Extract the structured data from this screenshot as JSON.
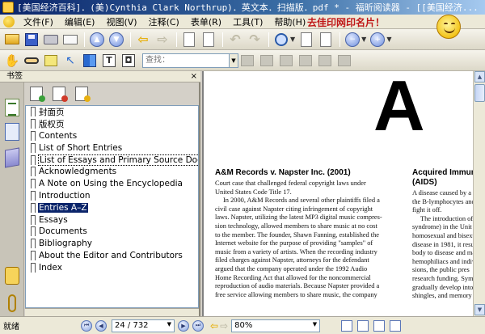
{
  "window": {
    "title": "[美国经济百科]．(美)Cynthia Clark Northrup)．英文本．扫描版．pdf * - 福昕阅读器 - [[美国经济..."
  },
  "menu": {
    "items": [
      "文件(F)",
      "编辑(E)",
      "视图(V)",
      "注释(C)",
      "表单(R)",
      "工具(T)",
      "帮助(H)"
    ],
    "brand_text": "去佳印网印名片！"
  },
  "toolbar": {
    "search_placeholder": "查找："
  },
  "panel": {
    "title": "书签",
    "close_label": "×",
    "bookmarks": [
      "封面页",
      "版权页",
      "Contents",
      "List of Short Entries",
      "List of Essays and Primary Source Documents",
      "Acknowledgments",
      "A Note on Using the Encyclopedia",
      "Introduction",
      "Entries A–Z",
      "Essays",
      "Documents",
      "Bibliography",
      "About the Editor and Contributors",
      "Index"
    ],
    "selected_index": 8,
    "boxed_index": 4
  },
  "document": {
    "big_letter": "A",
    "left_article": {
      "title": "A&M Records v. Napster Inc. (2001)",
      "lines": [
        "Court case that challenged federal copyright laws under",
        "United States Code Title 17.",
        "In 2000, A&M Records and several other plaintiffs filed a",
        "civil case against Napster citing infringement of copyright",
        "laws. Napster, utilizing the latest MP3 digital music compres-",
        "sion technology, allowed members to share music at no cost",
        "to the member. The founder, Shawn Fanning, established the",
        "Internet website for the purpose of providing \"samples\" of",
        "music from a variety of artists. When the recording industry",
        "filed charges against Napster, attorneys for the defendant",
        "argued that the company operated under the 1992 Audio",
        "Home Recording Act that allowed for the noncommercial",
        "reproduction of audio materials. Because Napster provided a",
        "free service allowing members to share music, the company"
      ]
    },
    "right_article": {
      "title": "Acquired Immun",
      "subtitle": "(AIDS)",
      "lines": [
        "A disease caused by a r",
        "the B-lymphocytes and",
        "fight it off.",
        "The introduction of",
        "syndrome) in the Unit",
        "homosexual and bisext",
        "disease in 1981, it resul",
        "body to disease and ma",
        "hemophiliacs and indiv",
        "sions, the public pres",
        "research funding. Symp",
        "gradually develop into",
        "shingles, and memory"
      ]
    }
  },
  "status": {
    "text": "就绪",
    "page_value": "24 / 732",
    "zoom_value": "80%"
  }
}
